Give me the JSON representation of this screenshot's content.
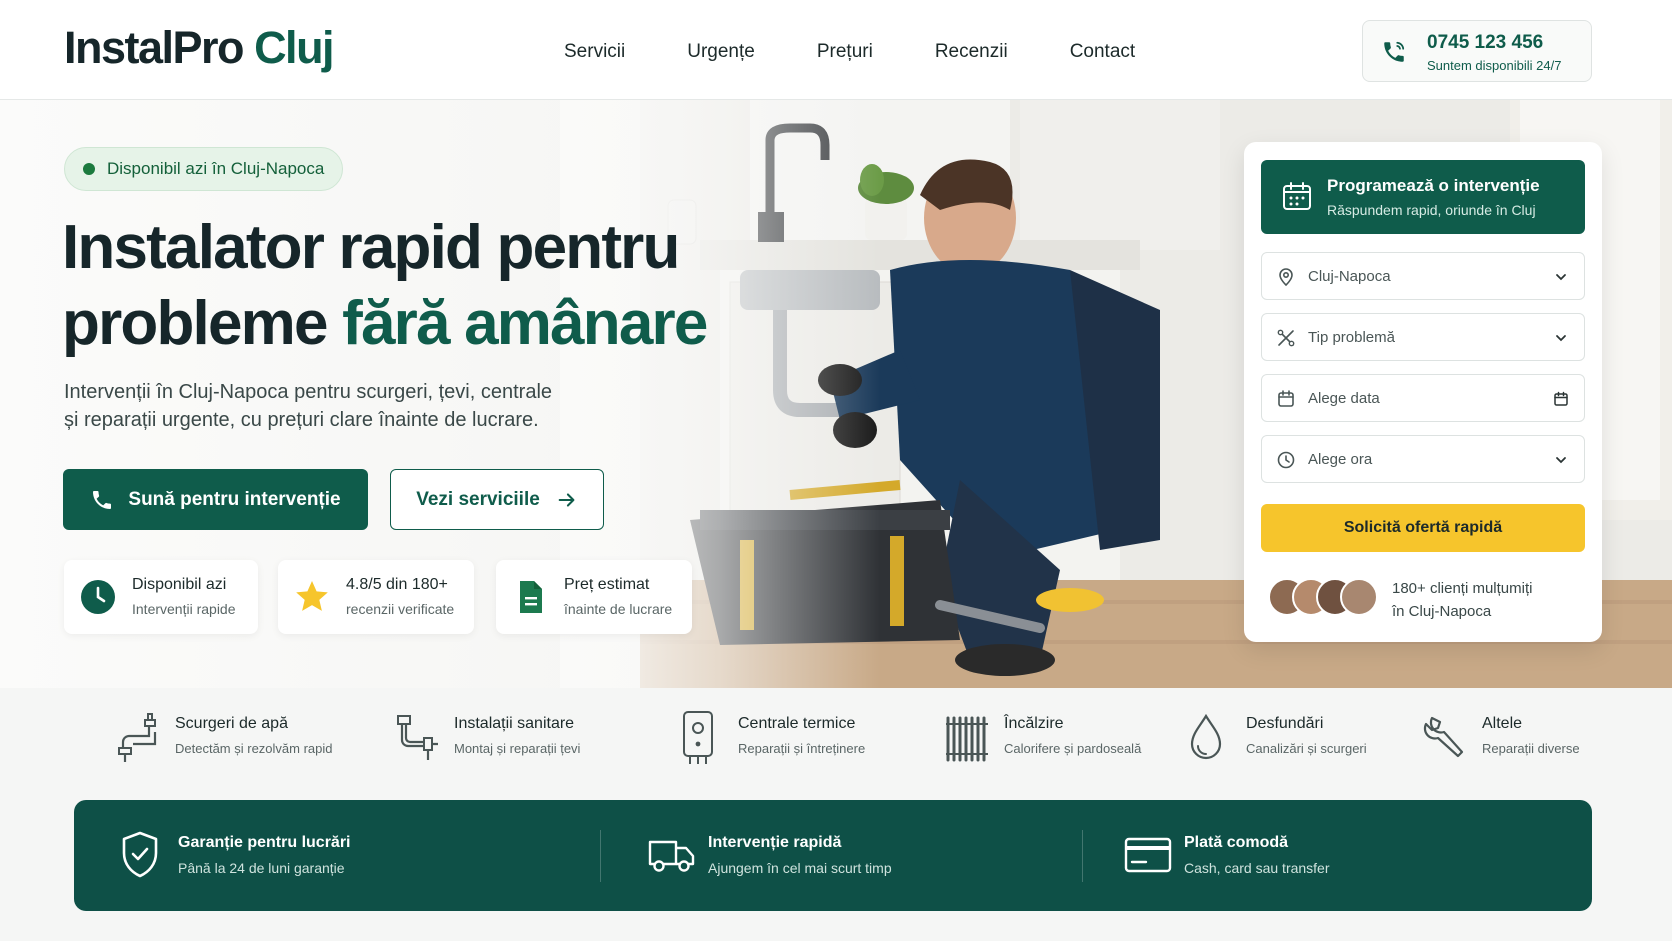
{
  "header": {
    "logo_main": "InstalPro",
    "logo_accent": "Cluj",
    "nav": [
      "Servicii",
      "Urgențe",
      "Prețuri",
      "Recenzii",
      "Contact"
    ],
    "phone_number": "0745 123 456",
    "phone_sub": "Suntem disponibili 24/7"
  },
  "hero": {
    "badge": "Disponibil azi în Cluj-Napoca",
    "title_line1": "Instalator rapid pentru",
    "title_line2_plain": "probleme",
    "title_line2_accent": "fără amânare",
    "lead_line1": "Intervenții în Cluj-Napoca pentru scurgeri, țevi, centrale",
    "lead_line2": "și reparații urgente, cu prețuri clare înainte de lucrare.",
    "primary_button": "Sună pentru intervenție",
    "secondary_button": "Vezi serviciile",
    "features": [
      {
        "title": "Disponibil azi",
        "subtitle": "Intervenții rapide",
        "icon": "clock-icon"
      },
      {
        "title": "4.8/5 din 180+",
        "subtitle": "recenzii verificate",
        "icon": "star-icon"
      },
      {
        "title": "Preț estimat",
        "subtitle": "înainte de lucrare",
        "icon": "document-icon"
      }
    ]
  },
  "booking": {
    "title": "Programează o intervenție",
    "subtitle": "Răspundem rapid, oriunde în Cluj",
    "location_value": "Cluj-Napoca",
    "problem_placeholder": "Tip problemă",
    "date_placeholder": "Alege data",
    "time_placeholder": "Alege ora",
    "cta": "Solicită ofertă rapidă",
    "social_line1": "180+ clienți mulțumiți",
    "social_line2": "în Cluj-Napoca"
  },
  "services": [
    {
      "title": "Scurgeri de apă",
      "subtitle": "Detectăm și rezolvăm rapid",
      "icon": "faucet-icon"
    },
    {
      "title": "Instalații sanitare",
      "subtitle": "Montaj și reparații țevi",
      "icon": "pipe-icon"
    },
    {
      "title": "Centrale termice",
      "subtitle": "Reparații și întreținere",
      "icon": "boiler-icon"
    },
    {
      "title": "Încălzire",
      "subtitle": "Calorifere și pardoseală",
      "icon": "radiator-icon"
    },
    {
      "title": "Desfundări",
      "subtitle": "Canalizări și scurgeri",
      "icon": "drop-icon"
    },
    {
      "title": "Altele",
      "subtitle": "Reparații diverse",
      "icon": "wrench-icon"
    }
  ],
  "guarantees": [
    {
      "title": "Garanție pentru lucrări",
      "subtitle": "Până la 24 de luni garanție",
      "icon": "shield-icon"
    },
    {
      "title": "Intervenție rapidă",
      "subtitle": "Ajungem în cel mai scurt timp",
      "icon": "truck-icon"
    },
    {
      "title": "Plată comodă",
      "subtitle": "Cash, card sau transfer",
      "icon": "card-icon"
    }
  ],
  "colors": {
    "brand": "#0f5c4b",
    "cta": "#f6c52c",
    "dark_band": "#0e5047"
  }
}
